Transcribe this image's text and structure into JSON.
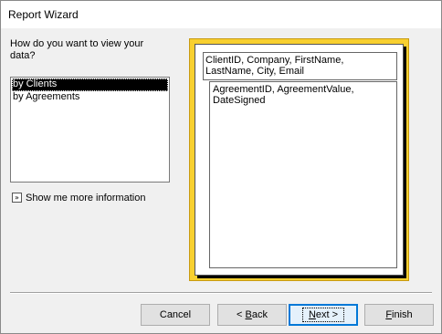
{
  "window": {
    "title": "Report Wizard"
  },
  "question": "How do you want to view your data?",
  "view_options": [
    {
      "label": "by Clients",
      "selected": true
    },
    {
      "label": "by Agreements",
      "selected": false
    }
  ],
  "show_more": {
    "label": "Show me more information",
    "icon": "more-info-icon"
  },
  "preview": {
    "group_fields": "ClientID, Company, FirstName, LastName, City, Email",
    "detail_fields": "AgreementID, AgreementValue, DateSigned",
    "frame_color": "#f8d030"
  },
  "buttons": {
    "cancel": "Cancel",
    "back_prefix": "< ",
    "back_key": "B",
    "back_rest": "ack",
    "next_key": "N",
    "next_rest": "ext >",
    "finish_key": "F",
    "finish_rest": "inish"
  }
}
